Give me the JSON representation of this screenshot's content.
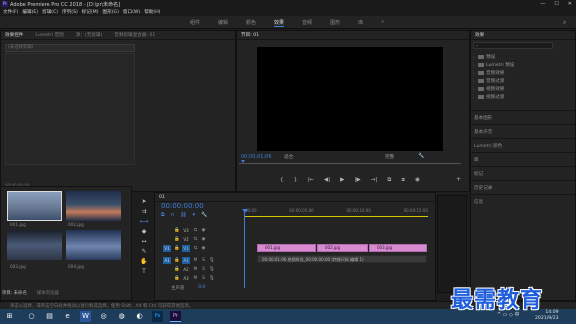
{
  "window": {
    "title": "Adobe Premiere Pro CC 2018 - [D:\\pr\\未命名]",
    "app_icon": "Pr"
  },
  "menu": [
    "文件(F)",
    "编辑(E)",
    "剪辑(C)",
    "序列(S)",
    "标记(M)",
    "图形(G)",
    "窗口(W)",
    "帮助(H)"
  ],
  "workspaces": {
    "tabs": [
      "组件",
      "编辑",
      "颜色",
      "效果",
      "音频",
      "图形",
      "库"
    ],
    "active": "效果",
    "more": "»"
  },
  "project_panel": {
    "tabs": [
      "效果控件",
      "Lumetri 范围",
      "源：(无剪辑)",
      "音频剪辑混合器: 01"
    ],
    "header": "(未选择剪辑)",
    "time": "00:00:00:00"
  },
  "program_monitor": {
    "title": "节目: 01",
    "timecode": "00;00;01;06",
    "fit": "适合",
    "quality": "完整",
    "transport": [
      "{",
      "}",
      "|←",
      "◀|",
      "▶",
      "|▶",
      "→|",
      "⧉",
      "⧈",
      "◉"
    ]
  },
  "effects_panel": {
    "title": "效果",
    "items": [
      "预设",
      "Lumetri 预设",
      "音频效果",
      "音频过渡",
      "视频效果",
      "视频过渡"
    ],
    "sections": [
      "基本图形",
      "基本声音",
      "Lumetri 颜色",
      "库",
      "标记",
      "历史记录",
      "信息"
    ]
  },
  "media_browser": {
    "tabs": [
      "项目: 未命名",
      "媒体浏览器"
    ],
    "thumbs": [
      {
        "label": "001.jpg",
        "dur": "",
        "colors": [
          "#3d4f6b",
          "#8aa0bf",
          "#6b7a93"
        ]
      },
      {
        "label": "002.jpg",
        "dur": "",
        "colors": [
          "#1f2e4a",
          "#c27a5b",
          "#3b4f6b"
        ]
      },
      {
        "label": "003.jpg",
        "dur": "",
        "colors": [
          "#1a1f2a",
          "#4a5a77",
          "#2f3648"
        ]
      },
      {
        "label": "004.jpg",
        "dur": "",
        "colors": [
          "#2a3b5c",
          "#6f86b0",
          "#203050"
        ]
      }
    ]
  },
  "timeline": {
    "title": "01",
    "timecode": "00:00:00:00",
    "ruler": [
      "00:00",
      "00:00:05:00",
      "00:00:10:00",
      "00:00:15:00"
    ],
    "tracks": [
      {
        "name": "V3",
        "target": ""
      },
      {
        "name": "V2",
        "target": ""
      },
      {
        "name": "V1",
        "target": "V1"
      },
      {
        "name": "A1",
        "target": "A1"
      },
      {
        "name": "A2",
        "target": ""
      },
      {
        "name": "A3",
        "target": ""
      }
    ],
    "master": {
      "label": "主声道",
      "value": "0.0"
    },
    "video_clips": [
      "001.jpg",
      "002.jpg",
      "003.jpg"
    ],
    "audio_clip": "00:00:01:06 热销时尚_00:00:00:00 (特效尺码 编辑 1)"
  },
  "status_bar": {
    "text": "单击以选择，或单击空白处并拖动以进行框选选择。使用 Shift、Alt 和 Ctrl 可获得其他选项。"
  },
  "taskbar": {
    "items": [
      "⊞",
      "○",
      "▤",
      "e",
      "W",
      "◎",
      "◍",
      "◐",
      "Ps",
      "Pr"
    ],
    "clock_time": "14:09",
    "clock_date": "2021/9/23",
    "tray": "^ ▭ ◇ 中"
  },
  "watermark": "最需教育",
  "colors": {
    "accent": "#3c7dd8",
    "clip_video": "#d989d2",
    "ruler_bar": "#d4c900",
    "watermark": "#1f5edb"
  }
}
